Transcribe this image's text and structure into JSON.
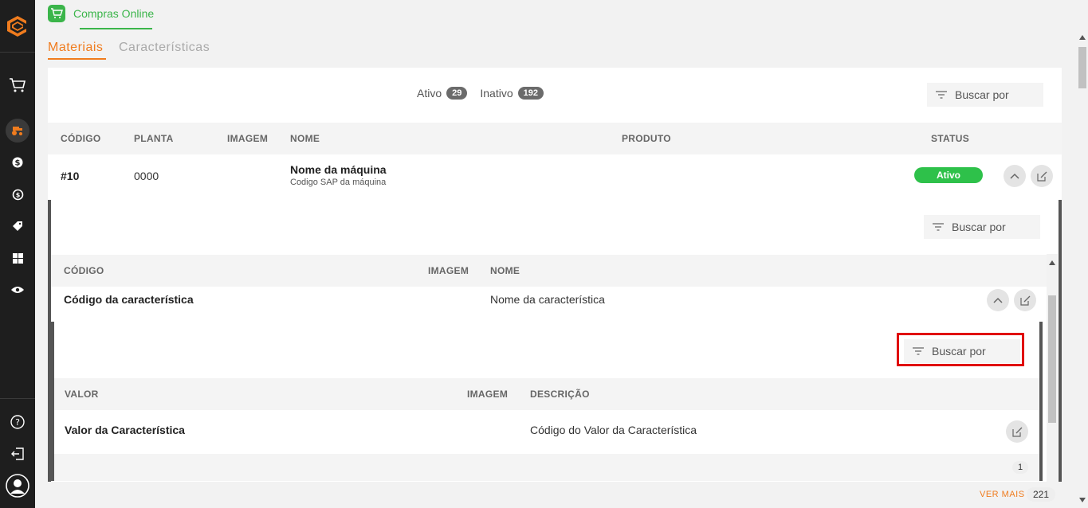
{
  "app": {
    "title": "Compras Online",
    "accent": "#3bb54a",
    "brand": "#f07c1e"
  },
  "sidebar": {
    "items": [
      {
        "icon": "cart-icon"
      },
      {
        "icon": "tractor-icon"
      },
      {
        "icon": "dollar-icon"
      },
      {
        "icon": "exchange-icon"
      },
      {
        "icon": "tag-icon"
      },
      {
        "icon": "grid-icon"
      },
      {
        "icon": "eye-icon"
      }
    ],
    "bottom": [
      {
        "icon": "help-icon"
      },
      {
        "icon": "logout-icon"
      },
      {
        "icon": "user-icon"
      }
    ]
  },
  "tabs": [
    {
      "label": "Materiais",
      "active": true
    },
    {
      "label": "Características",
      "active": false
    }
  ],
  "counts": {
    "ativo_label": "Ativo",
    "ativo_count": "29",
    "inativo_label": "Inativo",
    "inativo_count": "192"
  },
  "search": {
    "label": "Buscar por"
  },
  "main_table": {
    "headers": [
      "CÓDIGO",
      "PLANTA",
      "IMAGEM",
      "NOME",
      "PRODUTO",
      "STATUS"
    ],
    "row": {
      "codigo": "#10",
      "planta": "0000",
      "nome": "Nome da máquina",
      "nome_sub": "Codigo SAP da máquina",
      "status": "Ativo"
    }
  },
  "char_table": {
    "headers": [
      "CÓDIGO",
      "IMAGEM",
      "NOME"
    ],
    "row": {
      "codigo": "Código da característica",
      "nome": "Nome da característica"
    }
  },
  "value_table": {
    "headers": [
      "VALOR",
      "IMAGEM",
      "DESCRIÇÃO"
    ],
    "row": {
      "valor": "Valor da Característica",
      "descricao": "Código do Valor da Característica"
    },
    "page": "1"
  },
  "footer": {
    "ver_mais": "VER MAIS",
    "total": "221"
  }
}
